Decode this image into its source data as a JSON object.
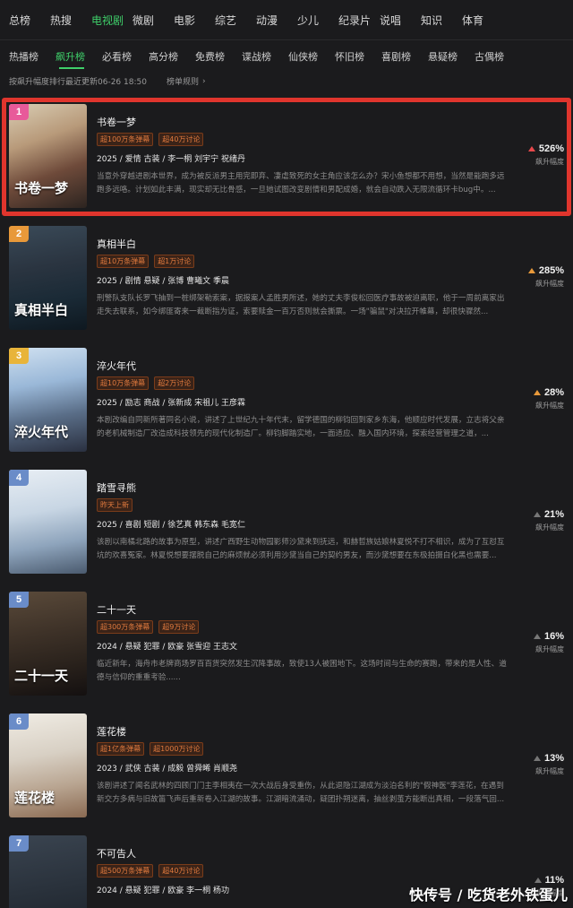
{
  "top_tabs": [
    "总榜",
    "热搜",
    "电视剧",
    "微剧",
    "电影",
    "综艺",
    "动漫",
    "少儿",
    "纪录片",
    "说唱",
    "知识",
    "体育"
  ],
  "top_tabs_active": 2,
  "sub_tabs": [
    "热播榜",
    "飙升榜",
    "必看榜",
    "高分榜",
    "免费榜",
    "谍战榜",
    "仙侠榜",
    "怀旧榜",
    "喜剧榜",
    "悬疑榜",
    "古偶榜"
  ],
  "sub_tabs_active": 1,
  "meta": {
    "update_text": "按飙升幅度排行最近更新06-26 18:50",
    "rule_text": "榜单规则"
  },
  "rise_label": "飙升幅度",
  "items": [
    {
      "rank": "1",
      "rank_color": "#e85a9a",
      "title": "书卷一梦",
      "badges": [
        "超100万条弹幕",
        "超40万讨论"
      ],
      "info": "2025 / 爱情 古装 / 李一桐 刘宇宁 祝绪丹",
      "desc": "当意外穿越进剧本世界，成为被反派男主用完即弃、凄虐致死的女主角应该怎么办？宋小鱼想都不用想，当然是能跑多远跑多远咯。计划如此丰满，现实却无比骨感，一旦她试图改变剧情和男配成婚，就会自动跌入无限流循环卡bug中。...",
      "pct": "526%",
      "arrow": "red",
      "poster_title": "书卷一梦",
      "poster_bg": "linear-gradient(160deg,#d9cdb4 0%,#b89a7a 35%,#6e4a3a 65%,#2c2420 100%)"
    },
    {
      "rank": "2",
      "rank_color": "#e8993a",
      "title": "真相半白",
      "badges": [
        "超10万条弹幕",
        "超1万讨论"
      ],
      "info": "2025 / 剧情 悬疑 / 张博 曹曦文 季晨",
      "desc": "刑警队支队长罗飞抽到一桩绑架勒索案，据报案人孟胜男所述，她的丈夫李俊松回医疗事故被迫离职，他于一周前离家出走失去联系，如今绑匪寄来一截断指为证，索要赎金一百万否则就会撕票。一场\"骗鼠\"对决拉开帷幕，却很快骤然...",
      "pct": "285%",
      "arrow": "orange",
      "poster_title": "真相半白",
      "poster_bg": "linear-gradient(170deg,#3a4a58 0%,#2a3440 40%,#1a2a36 70%,#0e1820 100%)"
    },
    {
      "rank": "3",
      "rank_color": "#e8b43a",
      "title": "淬火年代",
      "badges": [
        "超10万条弹幕",
        "超2万讨论"
      ],
      "info": "2025 / 励志 商战 / 张新成 宋祖儿 王彦霖",
      "desc": "本剧改编自同新所著同名小说，讲述了上世纪九十年代末，留学德国的柳钧回到家乡东海，他顺应时代发展，立志将父亲的老机械制造厂改造成科技领先的现代化制造厂。柳钧脚踏实地，一面适应、融入国内环境，探索经营管理之道，...",
      "pct": "28%",
      "arrow": "orange",
      "poster_title": "淬火年代",
      "poster_bg": "linear-gradient(170deg,#cfe0f0 0%,#9ab8d8 35%,#5a6e88 65%,#2a3040 100%)"
    },
    {
      "rank": "4",
      "rank_color": "#6a8cc8",
      "title": "踏雪寻熊",
      "badges": [
        "昨天上新"
      ],
      "info": "2025 / 喜剧 短剧 / 徐艺真 韩东森 毛宽仁",
      "desc": "该剧以南橘北路的故事为原型，讲述广西野生动物园影师沙黛来到抚远，和赫哲族姑娘林夏悦不打不相识，成为了互怼互坑的欢喜冤家。林夏悦想要摆脱自己的麻烦就必须利用沙黛当自己的契约男友，而沙黛想要在东极拍摄白化黑也需要...",
      "pct": "21%",
      "arrow": "gray",
      "poster_title": "",
      "poster_bg": "linear-gradient(170deg,#e8eef4 0%,#c8d6e4 40%,#8ea4bc 70%,#4a5a6e 100%)"
    },
    {
      "rank": "5",
      "rank_color": "#6a8cc8",
      "title": "二十一天",
      "badges": [
        "超300万条弹幕",
        "超9万讨论"
      ],
      "info": "2024 / 悬疑 犯罪 / 欧豪 张雪迎 王志文",
      "desc": "临近新年，海舟市老牌商场罗百百货突然发生沉降事故，致使13人被困地下。这场时间与生命的赛跑，带来的是人性、道德与信仰的重重考验......",
      "pct": "16%",
      "arrow": "gray",
      "poster_title": "二十一天",
      "poster_bg": "linear-gradient(170deg,#5a4a3a 0%,#3e3228 40%,#2a221c 70%,#141010 100%)"
    },
    {
      "rank": "6",
      "rank_color": "#6a8cc8",
      "title": "莲花楼",
      "badges": [
        "超1亿条弹幕",
        "超1000万讨论"
      ],
      "info": "2023 / 武侠 古装 / 成毅 曾舜晞 肖顺尧",
      "desc": "该剧讲述了闻名武林的四顾门门主李相夷在一次大战后身受重伤，从此退隐江湖成为淡泊名利的\"假神医\"李莲花，在遇到新交方多病与旧故笛飞声后重新卷入江湖的故事。江湖暗流涌动，疑团扑朔迷离，抽丝剥茧方能断出真相，一段落气回...",
      "pct": "13%",
      "arrow": "gray",
      "poster_title": "莲花楼",
      "poster_bg": "linear-gradient(170deg,#f0ece4 0%,#d8d0c4 40%,#b8a490 70%,#8a6a52 100%)"
    },
    {
      "rank": "7",
      "rank_color": "#6a8cc8",
      "title": "不可告人",
      "badges": [
        "超500万条弹幕",
        "超40万讨论"
      ],
      "info": "2024 / 悬疑 犯罪 / 欧豪 李一桐 杨功",
      "desc": "",
      "pct": "11%",
      "arrow": "gray",
      "poster_title": "",
      "poster_bg": "linear-gradient(170deg,#3a4450 0%,#2a323c 50%,#1a2028 100%)"
    }
  ],
  "watermark": "快传号 / 吃货老外铁蛋儿"
}
